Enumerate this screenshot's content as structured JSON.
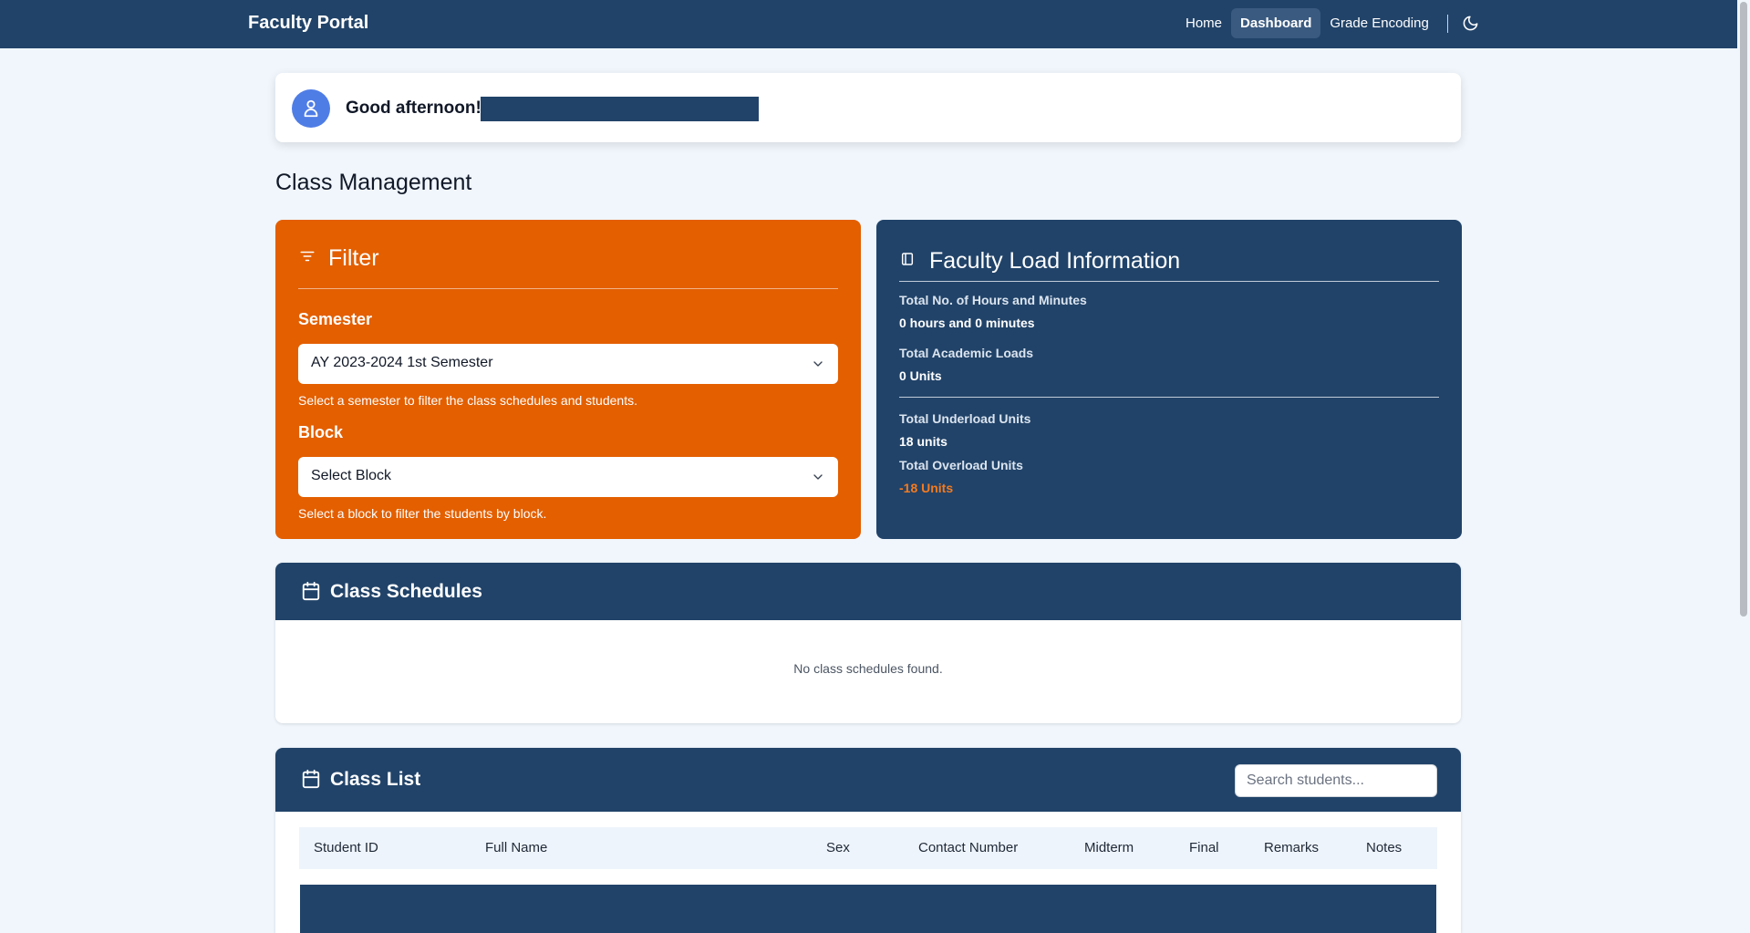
{
  "navbar": {
    "brand": "Faculty Portal",
    "links": [
      {
        "label": "Home",
        "active": false
      },
      {
        "label": "Dashboard",
        "active": true
      },
      {
        "label": "Grade Encoding",
        "active": false
      }
    ],
    "theme_toggle_icon": "moon-icon"
  },
  "greeting": {
    "text": "Good afternoon!",
    "avatar_icon": "user-icon"
  },
  "page_title": "Class Management",
  "filter": {
    "title": "Filter",
    "icon": "filter-icon",
    "semester_label": "Semester",
    "semester_value": "AY 2023-2024 1st Semester",
    "semester_hint": "Select a semester to filter the class schedules and students.",
    "block_label": "Block",
    "block_value": "Select Block",
    "block_hint": "Select a block to filter the students by block."
  },
  "faculty_load": {
    "title": "Faculty Load Information",
    "icon": "sidebar-panel-icon",
    "hours_label": "Total No. of Hours and Minutes",
    "hours_value": "0 hours and 0 minutes",
    "academic_label": "Total Academic Loads",
    "academic_value": "0 Units",
    "underload_label": "Total Underload Units",
    "underload_value": "18 units",
    "overload_label": "Total Overload Units",
    "overload_value": "-18 Units"
  },
  "class_schedules": {
    "title": "Class Schedules",
    "icon": "calendar-icon",
    "empty_text": "No class schedules found."
  },
  "class_list": {
    "title": "Class List",
    "icon": "calendar-icon",
    "search_placeholder": "Search students...",
    "columns": [
      "Student ID",
      "Full Name",
      "Sex",
      "Contact Number",
      "Midterm",
      "Final",
      "Remarks",
      "Notes"
    ]
  },
  "colors": {
    "primary": "#214369",
    "accent": "#e35f00",
    "overload": "#f47b20",
    "background": "#f0f6fc"
  }
}
